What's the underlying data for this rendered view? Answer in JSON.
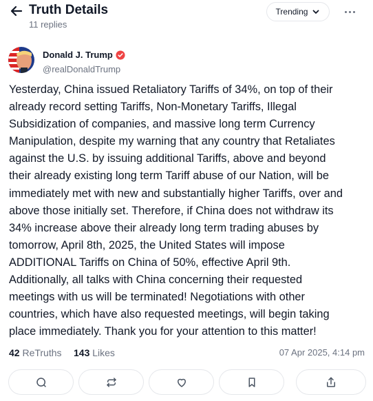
{
  "header": {
    "title": "Truth Details",
    "subtitle": "11 replies",
    "sort_label": "Trending",
    "back_icon": "arrow-left-icon",
    "more_icon": "ellipsis-icon"
  },
  "author": {
    "name": "Donald J. Trump",
    "handle": "@realDonaldTrump",
    "verified_color": "#ef4444"
  },
  "post": {
    "lines": [
      "Yesterday, China issued Retaliatory Tariffs of 34%, on top of their",
      "already record setting Tariffs, Non-Monetary Tariffs, Illegal",
      "Subsidization of companies, and massive long term Currency",
      "Manipulation, despite my warning that any country that Retaliates",
      "against the U.S. by issuing additional Tariffs, above and beyond",
      "their already existing long term Tariff abuse of our Nation, will be",
      "immediately met with new and substantially higher Tariffs, over and",
      "above those initially set. Therefore, if China does not withdraw its",
      "34% increase above their already long term trading abuses by",
      "tomorrow, April 8th, 2025, the United States will impose",
      "ADDITIONAL Tariffs on China of 50%, effective April 9th.",
      "Additionally, all talks with China concerning their requested",
      "meetings with us will be terminated! Negotiations with other",
      "countries, which have also requested meetings, will begin taking",
      "place immediately. Thank you for your attention to this matter!"
    ]
  },
  "stats": {
    "retruths_count": "42",
    "retruths_label": "ReTruths",
    "likes_count": "143",
    "likes_label": "Likes",
    "timestamp": "07 Apr 2025, 4:14 pm"
  },
  "actions": [
    {
      "name": "reply-button",
      "icon": "comment-icon"
    },
    {
      "name": "retruth-button",
      "icon": "repost-icon"
    },
    {
      "name": "like-button",
      "icon": "heart-icon"
    },
    {
      "name": "bookmark-button",
      "icon": "bookmark-icon"
    },
    {
      "name": "share-button",
      "icon": "share-icon"
    }
  ]
}
